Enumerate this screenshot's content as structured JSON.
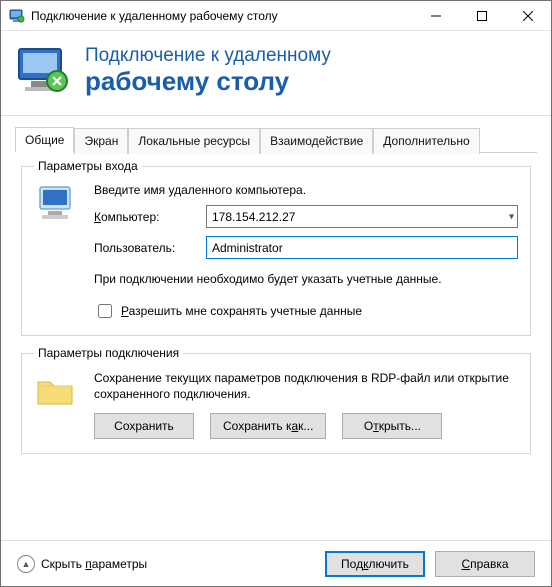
{
  "window": {
    "title": "Подключение к удаленному рабочему столу"
  },
  "banner": {
    "line1": "Подключение к удаленному",
    "line2": "рабочему столу"
  },
  "tabs": {
    "general": "Общие",
    "display": "Экран",
    "local_resources": "Локальные ресурсы",
    "experience": "Взаимодействие",
    "advanced": "Дополнительно",
    "active": "general"
  },
  "login_group": {
    "legend": "Параметры входа",
    "hint_top": "Введите имя удаленного компьютера.",
    "computer_label": "Компьютер:",
    "computer_value": "178.154.212.27",
    "user_label": "Пользователь:",
    "user_value": "Administrator",
    "hint_bottom": "При подключении необходимо будет указать учетные данные.",
    "remember_label": "Разрешить мне сохранять учетные данные",
    "remember_checked": false
  },
  "conn_group": {
    "legend": "Параметры подключения",
    "description": "Сохранение текущих параметров подключения в RDP-файл или открытие сохраненного подключения.",
    "save": "Сохранить",
    "save_as": "Сохранить как...",
    "open": "Открыть..."
  },
  "footer": {
    "hide_params": "Скрыть параметры",
    "connect": "Подключить",
    "help": "Справка"
  }
}
